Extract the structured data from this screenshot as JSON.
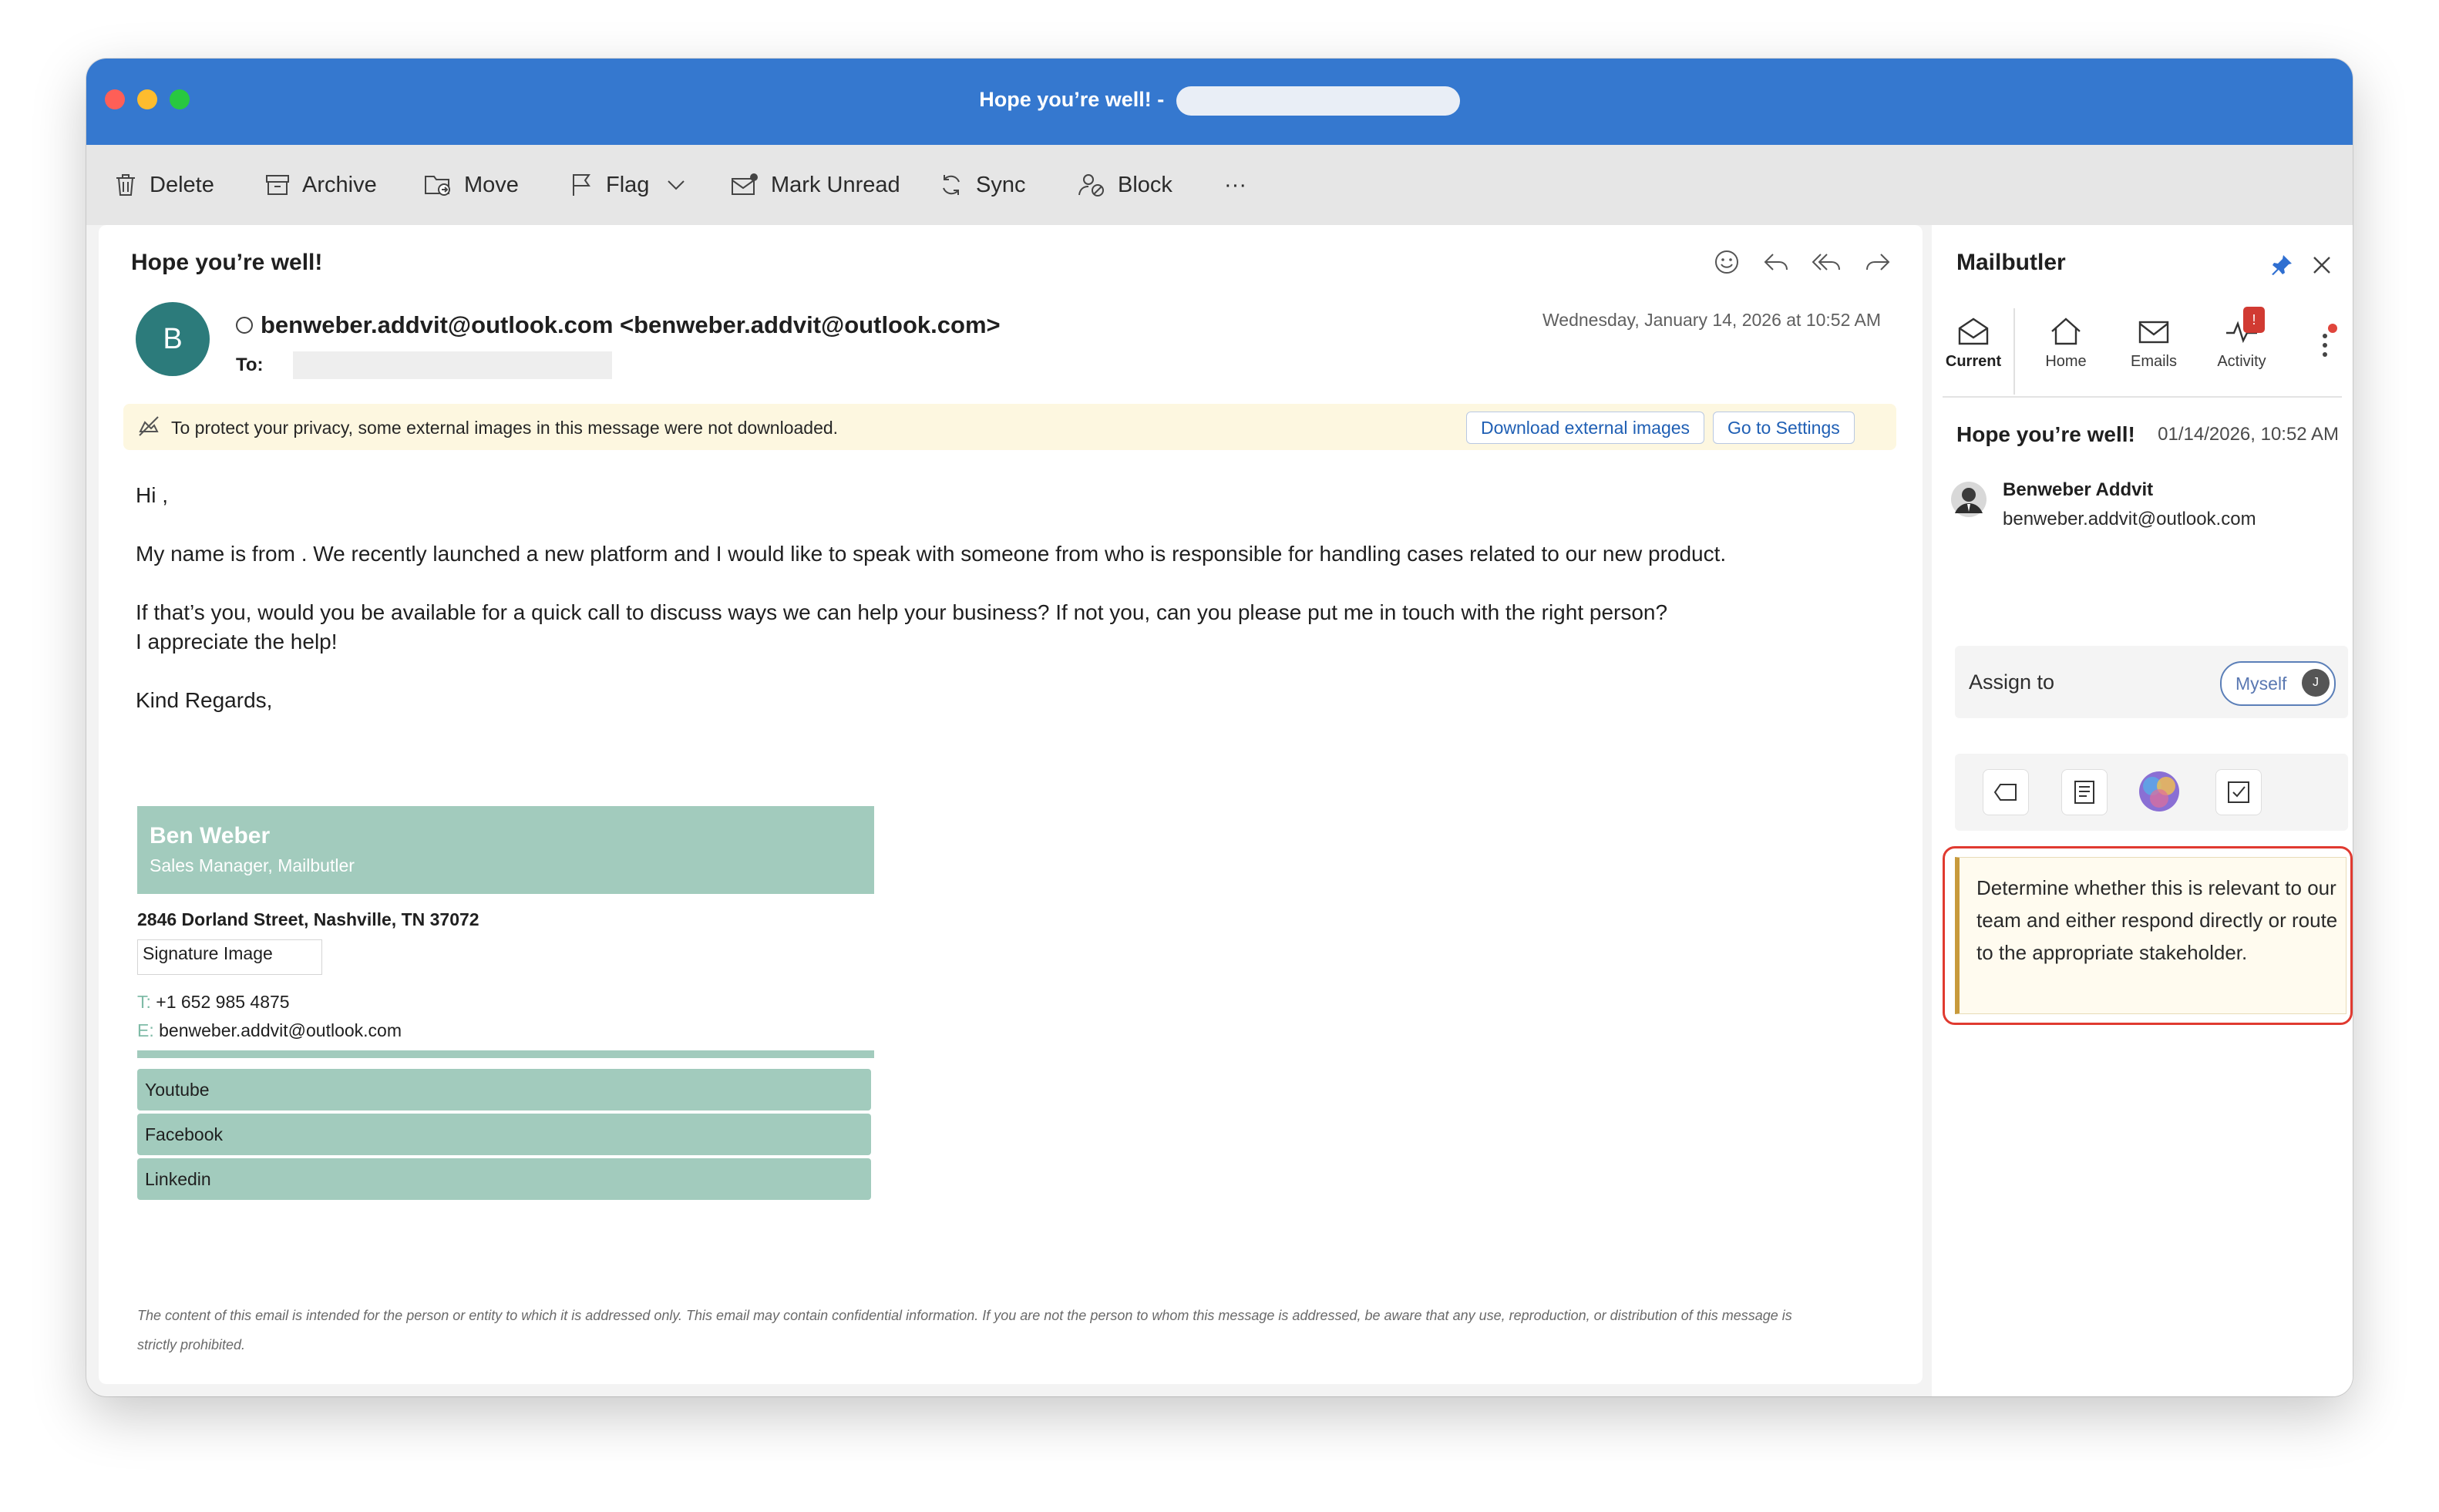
{
  "window": {
    "title": "Hope you’re well! -"
  },
  "toolbar": {
    "delete": "Delete",
    "archive": "Archive",
    "move": "Move",
    "flag": "Flag",
    "mark_unread": "Mark Unread",
    "sync": "Sync",
    "block": "Block",
    "more": "···"
  },
  "message": {
    "subject": "Hope you’re well!",
    "avatar_letter": "B",
    "from": "benweber.addvit@outlook.com <benweber.addvit@outlook.com>",
    "to_label": "To:",
    "date": "Wednesday, January 14, 2026 at 10:52 AM",
    "privacy_notice": "To protect your privacy, some external images in this message were not downloaded.",
    "download_button": "Download external images",
    "settings_button": "Go to Settings",
    "body": [
      "Hi ,",
      "My name is from . We recently launched a new platform and I would like to speak with someone from who is responsible for handling cases related to our new product.",
      "If that’s you, would you be available for a quick call to discuss ways we can help your business? If not you, can you please put me in touch with the right person?\nI appreciate the help!",
      "Kind Regards,"
    ],
    "signature": {
      "name": "Ben Weber",
      "role": "Sales Manager, Mailbutler",
      "address": "2846 Dorland Street, Nashville, TN 37072",
      "image_alt": "Signature Image",
      "phone_label": "T:",
      "phone": "+1 652 985 4875",
      "email_label": "E:",
      "email": "benweber.addvit@outlook.com",
      "socials": [
        "Youtube",
        "Facebook",
        "Linkedin"
      ]
    },
    "disclaimer": "The content of this email is intended for the person or entity to which it is addressed only. This email may contain confidential information. If you are not the person to whom this message is addressed, be aware that any use, reproduction, or distribution of this message is strictly prohibited."
  },
  "sidebar": {
    "title": "Mailbutler",
    "tabs": [
      {
        "label": "Current"
      },
      {
        "label": "Home"
      },
      {
        "label": "Emails"
      },
      {
        "label": "Activity",
        "badge": "!"
      }
    ],
    "message_subject": "Hope you’re well!",
    "message_date": "01/14/2026, 10:52 AM",
    "sender_name": "Benweber Addvit",
    "sender_email": "benweber.addvit@outlook.com",
    "assign_label": "Assign to",
    "assign_value": "Myself",
    "assign_initial": "J",
    "note": "Determine whether this is relevant to our team and either respond directly or route to the appropriate stakeholder."
  },
  "colors": {
    "titlebar": "#3578cf",
    "signature_green": "#a2cbbd",
    "highlight_red": "#e03a30",
    "link_blue": "#1f5fb4"
  }
}
